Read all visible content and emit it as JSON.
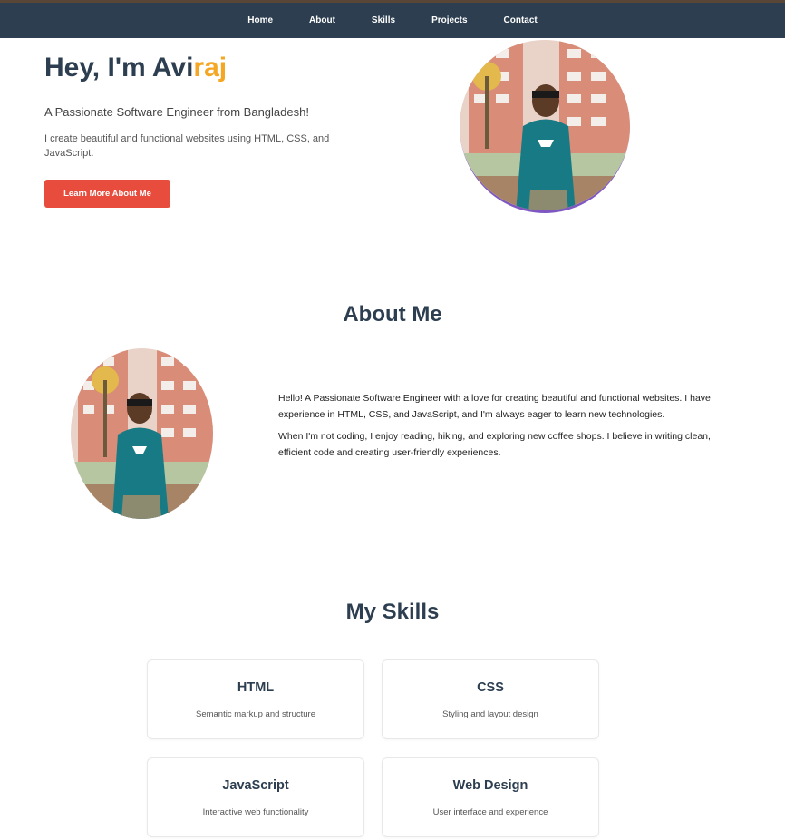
{
  "nav": {
    "items": [
      "Home",
      "About",
      "Skills",
      "Projects",
      "Contact"
    ]
  },
  "hero": {
    "title_prefix": "Hey, I'm Avi",
    "title_accent": "raj",
    "subtitle": "A Passionate Software Engineer from Bangladesh!",
    "description": "I create beautiful and functional websites using HTML, CSS, and JavaScript.",
    "button_label": "Learn More About Me"
  },
  "about": {
    "title": "About Me",
    "paragraph1": "Hello! A Passionate Software Engineer with a love for creating beautiful and functional websites. I have experience in HTML, CSS, and JavaScript, and I'm always eager to learn new technologies.",
    "paragraph2": "When I'm not coding, I enjoy reading, hiking, and exploring new coffee shops. I believe in writing clean, efficient code and creating user-friendly experiences."
  },
  "skills": {
    "title": "My Skills",
    "items": [
      {
        "name": "HTML",
        "desc": "Semantic markup and structure"
      },
      {
        "name": "CSS",
        "desc": "Styling and layout design"
      },
      {
        "name": "JavaScript",
        "desc": "Interactive web functionality"
      },
      {
        "name": "Web Design",
        "desc": "User interface and experience"
      }
    ]
  },
  "colors": {
    "nav_bg": "#2c3e50",
    "accent": "#f5a623",
    "button": "#e74c3c",
    "photo_border": "#7e57c2"
  }
}
